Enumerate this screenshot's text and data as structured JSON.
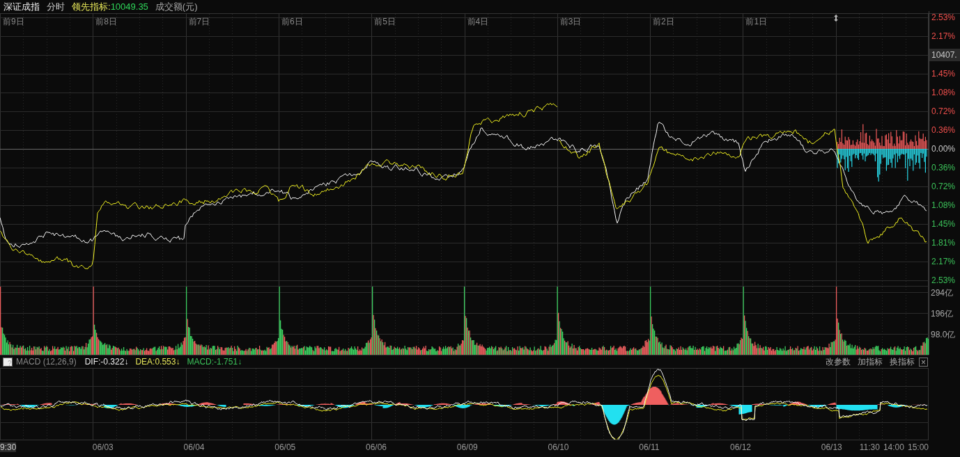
{
  "header": {
    "title": "深证成指",
    "mode": "分时",
    "indicator_label": "领先指标:",
    "indicator_value": "10049.35",
    "volume_label": "成交额(元)"
  },
  "day_labels": [
    "前9日",
    "前8日",
    "前7日",
    "前6日",
    "前5日",
    "前4日",
    "前3日",
    "前2日",
    "前1日"
  ],
  "price_axis": [
    {
      "label": "2.53%",
      "kind": "tick",
      "color": "#f2504d"
    },
    {
      "label": "2.17%",
      "kind": "tick",
      "color": "#f2504d"
    },
    {
      "label": "10407.",
      "kind": "marker"
    },
    {
      "label": "1.45%",
      "kind": "tick",
      "color": "#f2504d"
    },
    {
      "label": "1.08%",
      "kind": "tick",
      "color": "#f2504d"
    },
    {
      "label": "0.72%",
      "kind": "tick",
      "color": "#f2504d"
    },
    {
      "label": "0.36%",
      "kind": "tick",
      "color": "#f2504d"
    },
    {
      "label": "0.00%",
      "kind": "tick",
      "color": "#c8c8c8"
    },
    {
      "label": "0.36%",
      "kind": "tick",
      "color": "#3cc35a"
    },
    {
      "label": "0.72%",
      "kind": "tick",
      "color": "#3cc35a"
    },
    {
      "label": "1.08%",
      "kind": "tick",
      "color": "#3cc35a"
    },
    {
      "label": "1.45%",
      "kind": "tick",
      "color": "#3cc35a"
    },
    {
      "label": "1.81%",
      "kind": "tick",
      "color": "#3cc35a"
    },
    {
      "label": "2.17%",
      "kind": "tick",
      "color": "#3cc35a"
    },
    {
      "label": "2.53%",
      "kind": "tick",
      "color": "#3cc35a"
    }
  ],
  "volume_axis": [
    "294亿",
    "196亿",
    "98.0亿"
  ],
  "macd_bar": {
    "help": "?",
    "name": "MACD (12,26,9)",
    "dif": "DIF:-0.322↓",
    "dea": "DEA:0.553↓",
    "macd": "MACD:-1.751↓",
    "actions": [
      "改参数",
      "加指标",
      "换指标"
    ],
    "close": "×"
  },
  "time_axis": {
    "start": "9:30",
    "dates": [
      "06/03",
      "06/04",
      "06/05",
      "06/06",
      "06/09",
      "06/10",
      "06/11",
      "06/12",
      "06/13"
    ],
    "today_times": [
      "11:30",
      "14:00",
      "15:00"
    ]
  }
}
